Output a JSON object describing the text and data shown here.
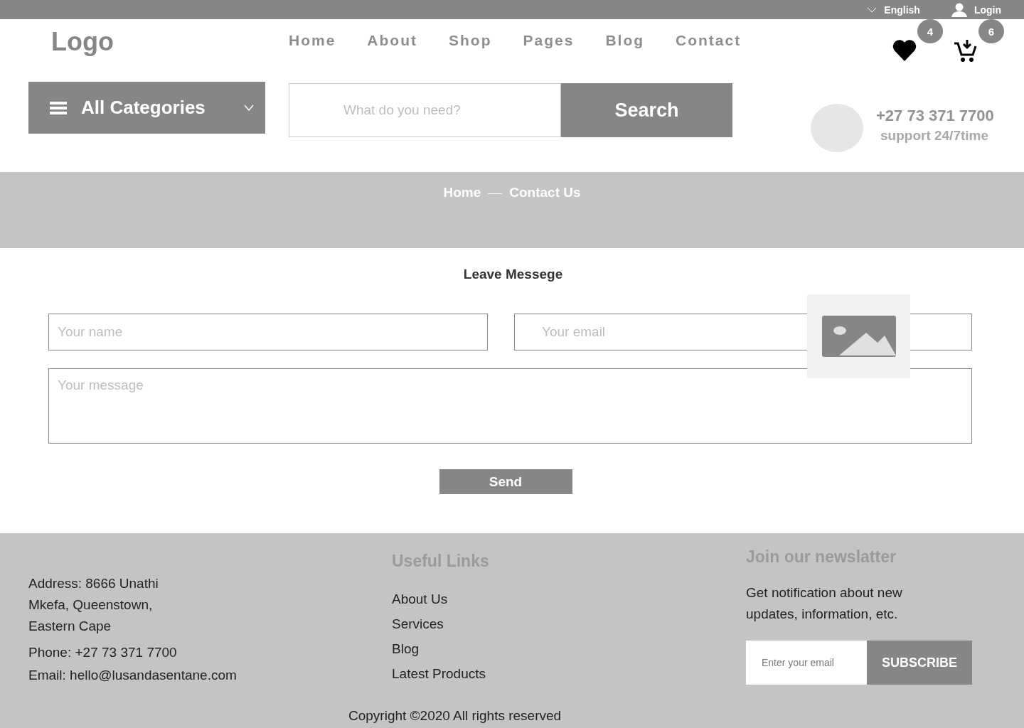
{
  "top_bar": {
    "language": "English",
    "login": "Login"
  },
  "header": {
    "logo": "Logo",
    "nav": [
      {
        "label": "Home"
      },
      {
        "label": "About"
      },
      {
        "label": "Shop"
      },
      {
        "label": "Pages"
      },
      {
        "label": "Blog"
      },
      {
        "label": "Contact"
      }
    ],
    "wishlist_count": "4",
    "cart_count": "6"
  },
  "search_row": {
    "categories": "All Categories",
    "search_placeholder": "What do you need?",
    "search_button": "Search",
    "phone": "+27 73 371 7700",
    "support": "support 24/7time"
  },
  "breadcrumb": [
    {
      "label": "Home"
    },
    {
      "label": "Contact Us"
    }
  ],
  "form": {
    "title": "Leave Messege",
    "name_placeholder": "Your name",
    "email_placeholder": "Your email",
    "message_placeholder": "Your message",
    "send": "Send"
  },
  "footer": {
    "address": "Address: 8666 Unathi Mkefa, Queenstown, Eastern Cape",
    "phone": "Phone: +27 73 371 7700",
    "email": "Email: hello@lusandasentane.com",
    "links_title": "Useful Links",
    "links": [
      "About Us",
      "Services",
      "Blog",
      "Latest Products"
    ],
    "newsletter_title": "Join our newslatter",
    "newsletter_text": "Get notification about new updates, information, etc.",
    "newsletter_placeholder": "Enter your email",
    "subscribe": "SUBSCRIBE",
    "copyright": "Copyright ©2020 All rights reserved"
  }
}
